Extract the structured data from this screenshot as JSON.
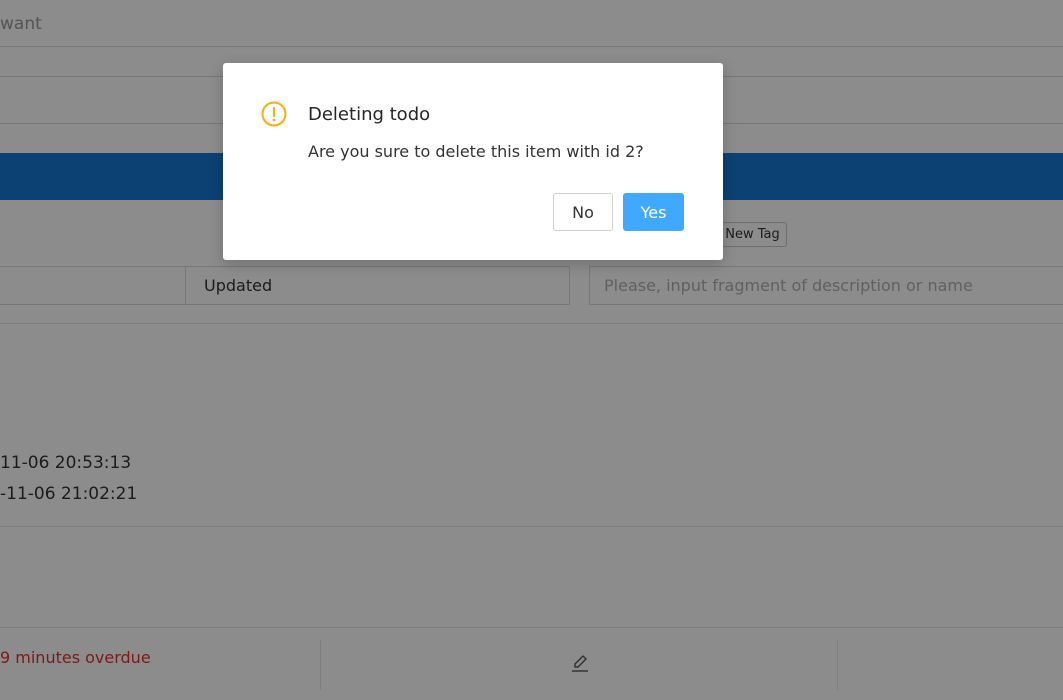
{
  "app": {
    "top_input_value": "want",
    "new_tag_label": "New Tag",
    "filter_left_value": "",
    "sort_value": "Updated",
    "search": {
      "placeholder": "Please, input fragment of description or name"
    },
    "todo": {
      "created": "11-06 20:53:13",
      "updated": "-11-06 21:02:21",
      "overdue_text": "9 minutes overdue",
      "edit_icon": "edit-icon"
    },
    "colors": {
      "band": "#1677d2",
      "overdue": "#e0302f"
    }
  },
  "dialog": {
    "icon": "exclamation-circle-icon",
    "title": "Deleting todo",
    "content": "Are you sure to delete this item with id 2?",
    "cancel_label": "No",
    "ok_label": "Yes",
    "colors": {
      "warning": "#faad14",
      "primary": "#40a9ff"
    }
  }
}
